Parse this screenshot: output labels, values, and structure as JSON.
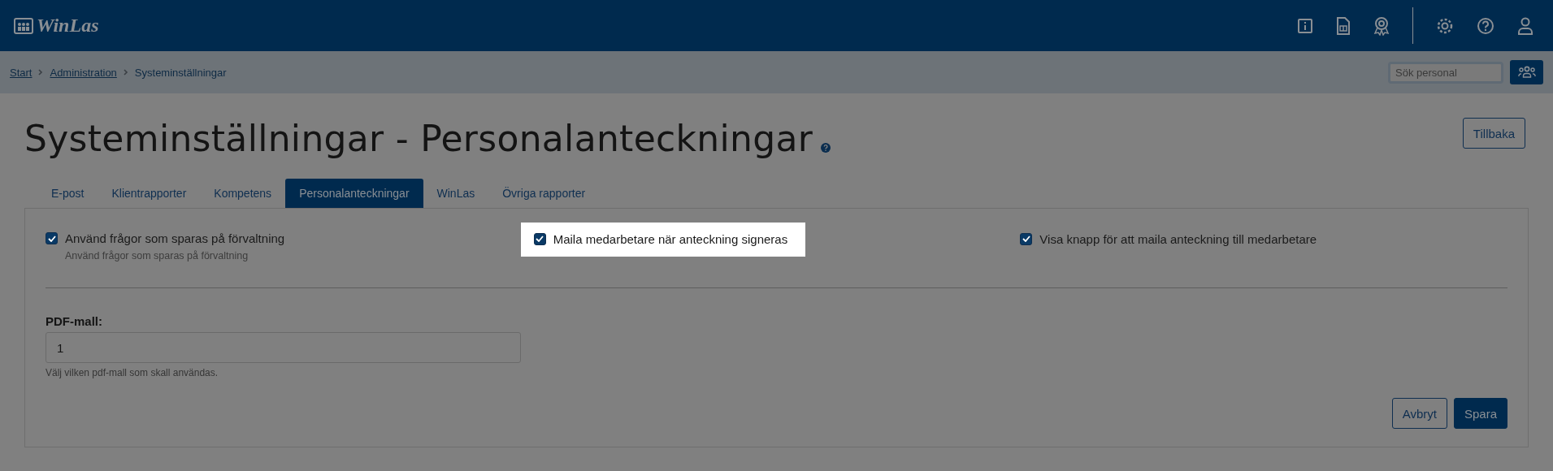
{
  "header": {
    "logo": "WinLas"
  },
  "breadcrumb": [
    {
      "label": "Start",
      "link": true
    },
    {
      "label": "Administration",
      "link": true
    },
    {
      "label": "Systeminställningar",
      "link": false
    }
  ],
  "search": {
    "placeholder": "Sök personal"
  },
  "title": "Systeminställningar - Personalanteckningar",
  "back_button": "Tillbaka",
  "tabs": [
    {
      "label": "E-post",
      "selected": false
    },
    {
      "label": "Klientrapporter",
      "selected": false
    },
    {
      "label": "Kompetens",
      "selected": false
    },
    {
      "label": "Personalanteckningar",
      "selected": true
    },
    {
      "label": "WinLas",
      "selected": false
    },
    {
      "label": "Övriga rapporter",
      "selected": false
    }
  ],
  "options": [
    {
      "label": "Använd frågor som sparas på förvaltning",
      "description": "Använd frågor som sparas på förvaltning",
      "checked": true,
      "highlighted": false
    },
    {
      "label": "Maila medarbetare när anteckning signeras",
      "checked": true,
      "highlighted": true
    },
    {
      "label": "Visa knapp för att maila anteckning till medarbetare",
      "checked": true,
      "highlighted": false
    }
  ],
  "pdf_template": {
    "label": "PDF-mall:",
    "value": "1",
    "help": "Välj vilken pdf-mall som skall användas."
  },
  "buttons": [
    {
      "label": "Avbryt",
      "kind": "secondary"
    },
    {
      "label": "Spara",
      "kind": "primary"
    }
  ]
}
